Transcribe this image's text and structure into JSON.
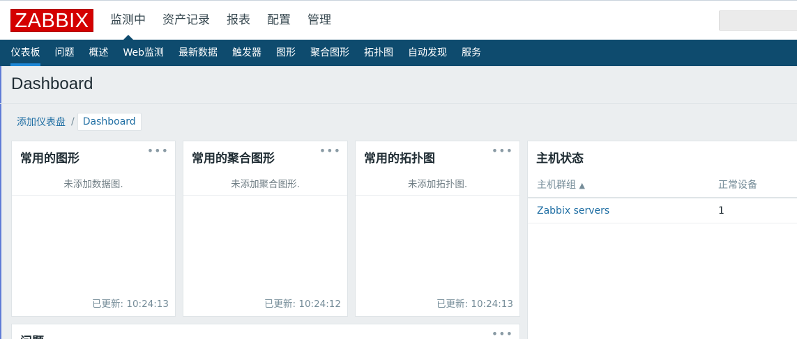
{
  "header": {
    "logo": "ZABBIX",
    "nav": [
      {
        "label": "监测中",
        "active": true
      },
      {
        "label": "资产记录"
      },
      {
        "label": "报表"
      },
      {
        "label": "配置"
      },
      {
        "label": "管理"
      }
    ]
  },
  "subnav": [
    {
      "label": "仪表板",
      "active": true
    },
    {
      "label": "问题"
    },
    {
      "label": "概述"
    },
    {
      "label": "Web监测"
    },
    {
      "label": "最新数据"
    },
    {
      "label": "触发器"
    },
    {
      "label": "图形"
    },
    {
      "label": "聚合图形"
    },
    {
      "label": "拓扑图"
    },
    {
      "label": "自动发现"
    },
    {
      "label": "服务"
    }
  ],
  "page": {
    "title": "Dashboard"
  },
  "breadcrumb": {
    "link": "添加仪表盘",
    "separator": "/",
    "current": "Dashboard"
  },
  "widgets": {
    "graphs": {
      "title": "常用的图形",
      "menu": "•••",
      "empty": "未添加数据图.",
      "updated": "已更新: 10:24:13"
    },
    "screens": {
      "title": "常用的聚合图形",
      "menu": "•••",
      "empty": "未添加聚合图形.",
      "updated": "已更新: 10:24:12"
    },
    "maps": {
      "title": "常用的拓扑图",
      "menu": "•••",
      "empty": "未添加拓扑图.",
      "updated": "已更新: 10:24:13"
    },
    "problems": {
      "title": "问题",
      "menu": "•••"
    },
    "host_status": {
      "title": "主机状态",
      "columns": [
        "主机群组",
        "正常设备"
      ],
      "sort_indicator": "▲",
      "rows": [
        {
          "group": "Zabbix servers",
          "ok": "1"
        }
      ]
    }
  },
  "colors": {
    "brand": "#d40000",
    "subnav_bg": "#0e4b6e",
    "active_underline": "#1e87d6",
    "link": "#1f6ea3"
  }
}
